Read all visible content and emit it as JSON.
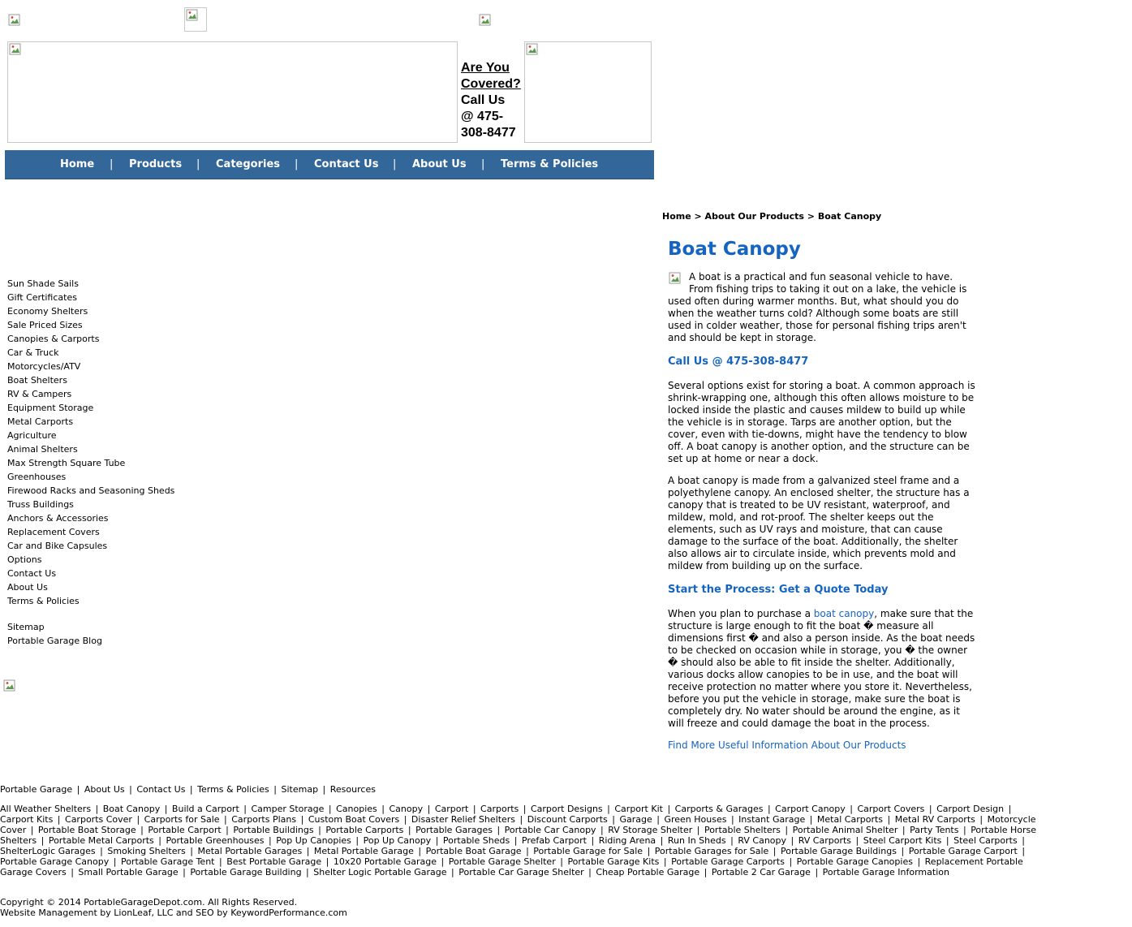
{
  "header": {
    "covered_line1": "Are You",
    "covered_line2": "Covered?",
    "call_line1": "Call Us",
    "call_line2": "@ 475-",
    "call_line3": "308-8477"
  },
  "nav": {
    "items": [
      "Home",
      "Products",
      "Categories",
      "Contact Us",
      "About Us",
      "Terms & Policies"
    ],
    "separator": "|"
  },
  "sidebar": {
    "items": [
      "Sun Shade Sails",
      "Gift Certificates",
      "Economy Shelters",
      "Sale Priced Sizes",
      "Canopies & Carports",
      "Car & Truck",
      "Motorcycles/ATV",
      "Boat Shelters",
      "RV & Campers",
      "Equipment Storage",
      "Metal Carports",
      "Agriculture",
      "Animal Shelters",
      "Max Strength Square Tube",
      "Greenhouses",
      "Firewood Racks and Seasoning Sheds",
      "Truss Buildings",
      "Anchors & Accessories",
      "Replacement Covers",
      "Car and Bike Capsules",
      "Options",
      "Contact Us",
      "About Us",
      "Terms & Policies"
    ],
    "extra_items": [
      "Sitemap",
      "Portable Garage Blog"
    ]
  },
  "breadcrumb": {
    "text": "Home > About Our Products > Boat Canopy"
  },
  "article": {
    "title": "Boat Canopy",
    "p1": "A boat is a practical and fun seasonal vehicle to have. From fishing trips to taking it out on a lake, the vehicle is used often during warmer months. But, what should you do when the weather turns cold? Although some boats are still used in colder weather, those for personal fishing trips aren't and should be kept in storage.",
    "call_heading": "Call Us @ 475-308-8477",
    "p2": "Several options exist for storing a boat. A common approach is shrink-wrapping one, although this often allows moisture to be locked inside the plastic and causes mildew to build up while the vehicle is in storage. Tarps are another option, but the cover, even with tie-downs, might have the tendency to blow off. A boat canopy is another option, and the structure can be set up at home or near a dock.",
    "p3": "A boat canopy is made from a galvanized steel frame and a polyethylene canopy. An enclosed shelter, the structure has a canopy that is treated to be UV resistant, waterproof, and mildew, mold, and rot-proof. The shelter keeps out the elements, such as UV rays and moisture, that can cause damage to the surface of the boat. Additionally, the shelter also allows air to circulate inside, which prevents mold and mildew from building up on the surface.",
    "quote_heading": "Start the Process: Get a Quote Today",
    "p4_before": "When you plan to purchase a ",
    "p4_link": "boat canopy",
    "p4_after": ", make sure that the structure is large enough to fit the boat � measure all dimensions first � and also a person inside. As the boat needs to be checked on occasion while in storage, you � the owner � should also be able to fit inside the shelter. Additionally, various docks allow canopies to be in use, and the boat will receive protection no matter where you store it. Nevertheless, before you put the vehicle in storage, make sure the boat is completely dry. No water should be around the engine, as it will freeze and could damage the boat in the process.",
    "more_link": "Find More Useful Information About Our Products"
  },
  "footer": {
    "nav": [
      "Portable Garage",
      "About Us",
      "Contact Us",
      "Terms & Policies",
      "Sitemap",
      "Resources"
    ],
    "keywords": [
      "All Weather Shelters",
      "Boat Canopy",
      "Build a Carport",
      "Camper Storage",
      "Canopies",
      "Canopy",
      "Carport",
      "Carports",
      "Carport Designs",
      "Carport Kit",
      "Carports & Garages",
      "Carport Canopy",
      "Carport Covers",
      "Carport Design",
      "Carport Kits",
      "Carports Cover",
      "Carports for Sale",
      "Carports Plans",
      "Custom Boat Covers",
      "Disaster Relief Shelters",
      "Discount Carports",
      "Garage",
      "Green Houses",
      "Instant Garage",
      "Metal Carports",
      "Metal RV Carports",
      "Motorcycle Cover",
      "Portable Boat Storage",
      "Portable Carport",
      "Portable Buildings",
      "Portable Carports",
      "Portable Garages",
      "Portable Car Canopy",
      "RV Storage Shelter",
      "Portable Shelters",
      "Portable Animal Shelter",
      "Party Tents",
      "Portable Horse Shelters",
      "Portable Metal Carports",
      "Portable Greenhouses",
      "Pop Up Canopies",
      "Pop Up Canopy",
      "Portable Sheds",
      "Prefab Carport",
      "Riding Arena",
      "Run In Sheds",
      "RV Canopy",
      "RV Carports",
      "Steel Carport Kits",
      "Steel Carports",
      "ShelterLogic Garages",
      "Smoking Shelters",
      "Metal Portable Garages",
      "Metal Portable Garage",
      "Portable Boat Garage",
      "Portable Garage for Sale",
      "Portable Garages for Sale",
      "Portable Garage Buildings",
      "Portable Garage Carport",
      "Portable Garage Canopy",
      "Portable Garage Tent",
      "Best Portable Garage",
      "10x20 Portable Garage",
      "Portable Garage Shelter",
      "Portable Garage Kits",
      "Portable Garage Carports",
      "Portable Garage Canopies",
      "Replacement Portable Garage Covers",
      "Small Portable Garage",
      "Portable Garage Building",
      "Shelter Logic Portable Garage",
      "Portable Car Garage Shelter",
      "Cheap Portable Garage",
      "Portable 2 Car Garage",
      "Portable Garage Information"
    ],
    "copyright": "Copyright © 2014 PortableGarageDepot.com. All Rights Reserved.",
    "management": "Website Management by LionLeaf, LLC and SEO by KeywordPerformance.com"
  }
}
